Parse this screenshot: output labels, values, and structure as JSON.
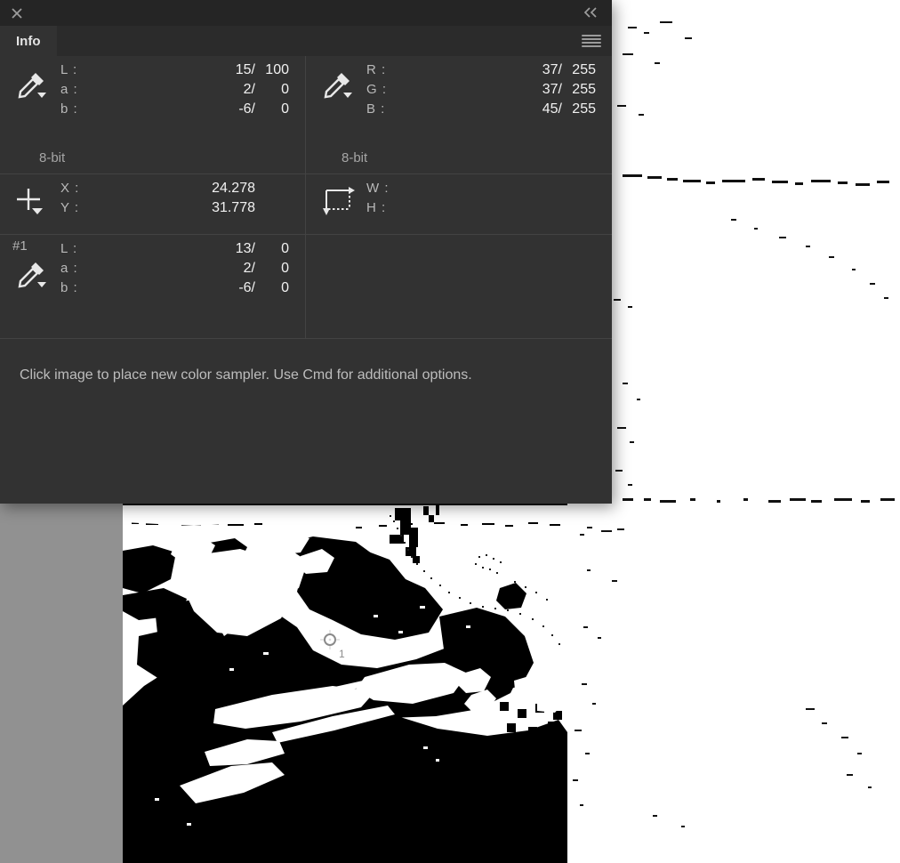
{
  "app": {
    "canvas_background_color": "#ffffff",
    "canvas_gray_color": "#919191"
  },
  "panel": {
    "title": "Info",
    "close_icon": "close-icon",
    "collapse_icon": "double-chevron-left-icon",
    "menu_icon": "hamburger-menu-icon",
    "background_color": "#323232",
    "titlebar_color": "#252525",
    "tabs": [
      {
        "label": "Info",
        "active": true
      }
    ],
    "hint": "Click image to place new color sampler.  Use Cmd for additional options."
  },
  "readouts": {
    "lab": {
      "icon": "eyedropper-icon",
      "rows": [
        {
          "label": "L :",
          "before": "15/",
          "after": "100"
        },
        {
          "label": "a :",
          "before": "2/",
          "after": "0"
        },
        {
          "label": "b :",
          "before": "-6/",
          "after": "0"
        }
      ],
      "bit_depth": "8-bit"
    },
    "rgb": {
      "icon": "eyedropper-icon",
      "rows": [
        {
          "label": "R :",
          "before": "37/",
          "after": "255"
        },
        {
          "label": "G :",
          "before": "37/",
          "after": "255"
        },
        {
          "label": "B :",
          "before": "45/",
          "after": "255"
        }
      ],
      "bit_depth": "8-bit"
    },
    "position": {
      "icon": "crosshair-icon",
      "rows": [
        {
          "label": "X :",
          "value": "24.278"
        },
        {
          "label": "Y :",
          "value": "31.778"
        }
      ]
    },
    "dimensions": {
      "icon": "selection-size-icon",
      "rows": [
        {
          "label": "W :",
          "value": ""
        },
        {
          "label": "H :",
          "value": ""
        }
      ]
    },
    "sampler1": {
      "index": "#1",
      "icon": "eyedropper-icon",
      "rows": [
        {
          "label": "L :",
          "before": "13/",
          "after": "0"
        },
        {
          "label": "a :",
          "before": "2/",
          "after": "0"
        },
        {
          "label": "b :",
          "before": "-6/",
          "after": "0"
        }
      ]
    },
    "empty_cell": {
      "rows": []
    }
  },
  "image_canvas": {
    "sampler_marker": {
      "name": "color-sampler-marker",
      "label": "1"
    }
  }
}
